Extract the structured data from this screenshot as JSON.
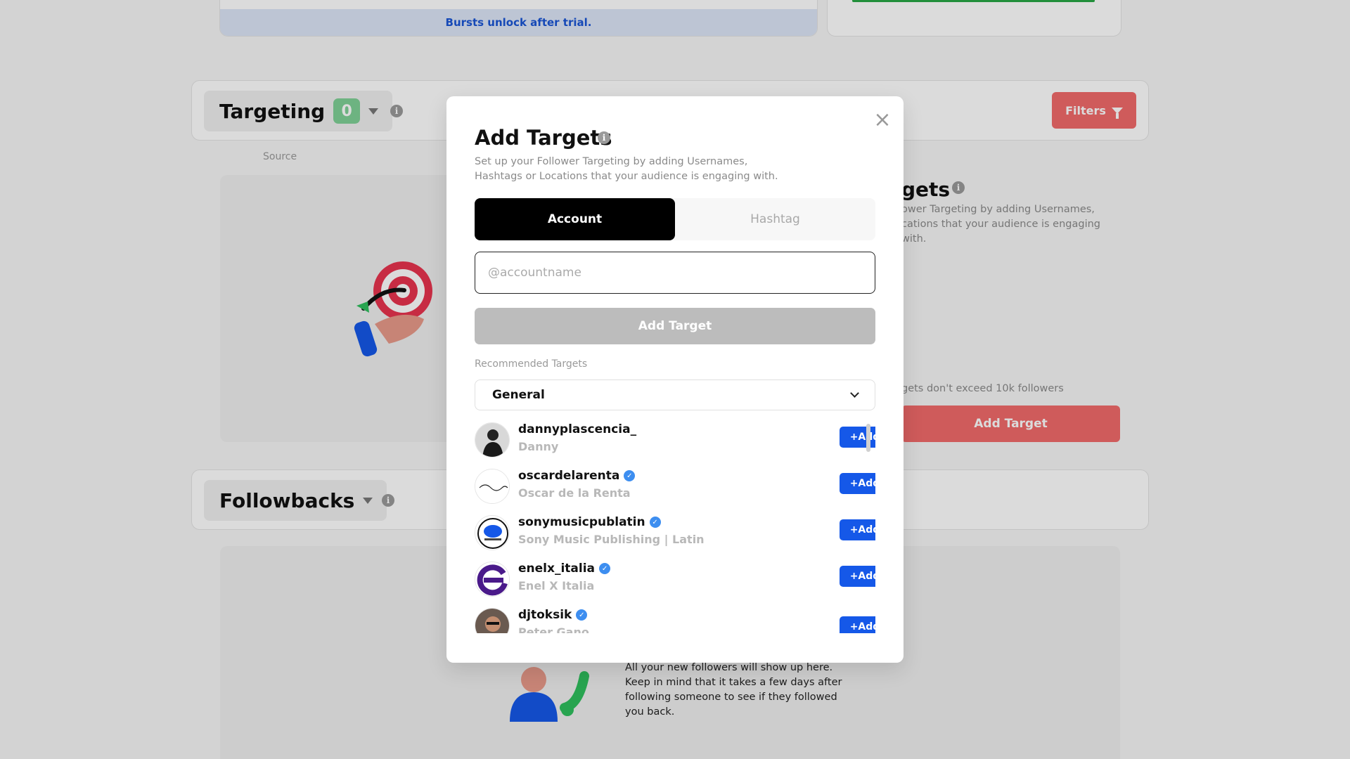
{
  "background": {
    "burst_notice": "Bursts unlock after trial.",
    "targeting": {
      "title": "Targeting",
      "count": "0",
      "filters_label": "Filters",
      "source_label": "Source",
      "right_title": "gets",
      "right_desc": "ower Targeting by adding Usernames, cations that your audience is engaging with.",
      "right_note": "gets don't exceed 10k followers",
      "right_add_label": "Add Target"
    },
    "followbacks": {
      "title": "Followbacks",
      "empty_text": "All your new followers will show up here. Keep in mind that it takes a few days after following someone to see if they followed you back."
    }
  },
  "modal": {
    "title": "Add Targets",
    "description": "Set up your Follower Targeting by adding Usernames, Hashtags or Locations that your audience is engaging with.",
    "tabs": [
      {
        "label": "Account",
        "active": true
      },
      {
        "label": "Hashtag",
        "active": false
      }
    ],
    "input_placeholder": "@accountname",
    "input_value": "",
    "add_target_label": "Add Target",
    "recommended_label": "Recommended Targets",
    "category_selected": "General",
    "add_label": "+Add",
    "targets": [
      {
        "username": "dannyplascencia_",
        "display_name": "Danny",
        "verified": false
      },
      {
        "username": "oscardelarenta",
        "display_name": "Oscar de la Renta",
        "verified": true
      },
      {
        "username": "sonymusicpublatin",
        "display_name": "Sony Music Publishing | Latin",
        "verified": true
      },
      {
        "username": "enelx_italia",
        "display_name": "Enel X Italia",
        "verified": true
      },
      {
        "username": "djtoksik",
        "display_name": "Peter Gano",
        "verified": true
      }
    ]
  },
  "colors": {
    "accent_red": "#f26b6b",
    "add_blue": "#1558e8",
    "badge_green": "#7fd197"
  }
}
